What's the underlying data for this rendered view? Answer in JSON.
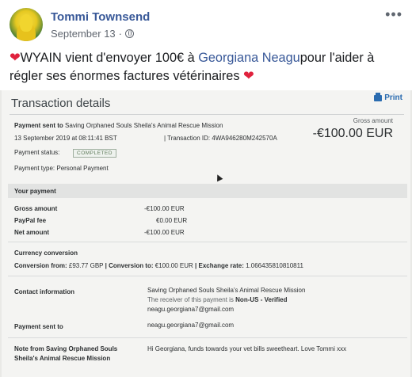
{
  "post": {
    "author": "Tommi Townsend",
    "date": "September 13",
    "date_sep": "·",
    "more": "•••",
    "caption_pre": "WYAIN vient d'envoyer 100€ à ",
    "caption_link": "Georgiana Neagu",
    "caption_post": "pour l'aider à régler ses énormes factures vétérinaires ",
    "heart": "❤"
  },
  "tx": {
    "title": "Transaction details",
    "print": "Print",
    "sent_to_label": "Payment sent to",
    "sent_to_value": "Saving Orphaned Souls Sheila's Animal Rescue Mission",
    "datetime": "13 September 2019 at 08:11:41 BST",
    "txid_label": "Transaction ID:",
    "txid": "4WA946280M242570A",
    "gross_label_top": "Gross amount",
    "gross_big": "-€100.00 EUR",
    "status_label": "Payment status:",
    "status": "COMPLETED",
    "ptype": "Payment type: Personal Payment",
    "your_payment": "Your payment",
    "gross_amount": "Gross amount",
    "gross_val": "-€100.00 EUR",
    "fee": "PayPal fee",
    "fee_val": "€0.00 EUR",
    "net": "Net amount",
    "net_val": "-€100.00 EUR",
    "cc": "Currency conversion",
    "conv_from_label": "Conversion from:",
    "conv_from": "£93.77 GBP",
    "conv_to_label": "Conversion to:",
    "conv_to": "€100.00 EUR",
    "rate_label": "Exchange rate:",
    "rate": "1.066435810810811",
    "bar": "|",
    "contact_label": "Contact information",
    "contact_name": "Saving Orphaned Souls Sheila's Animal Rescue Mission",
    "receiver_pre": "The receiver of this payment is ",
    "receiver_status": "Non-US - Verified",
    "contact_email": "neagu.georgiana7@gmail.com",
    "sent_to2_label": "Payment sent to",
    "sent_to2": "neagu.georgiana7@gmail.com",
    "note_label_1": "Note from Saving Orphaned Souls",
    "note_label_2": "Sheila's Animal Rescue Mission",
    "note": "Hi Georgiana, funds towards your vet bills sweetheart. Love Tommi xxx"
  }
}
